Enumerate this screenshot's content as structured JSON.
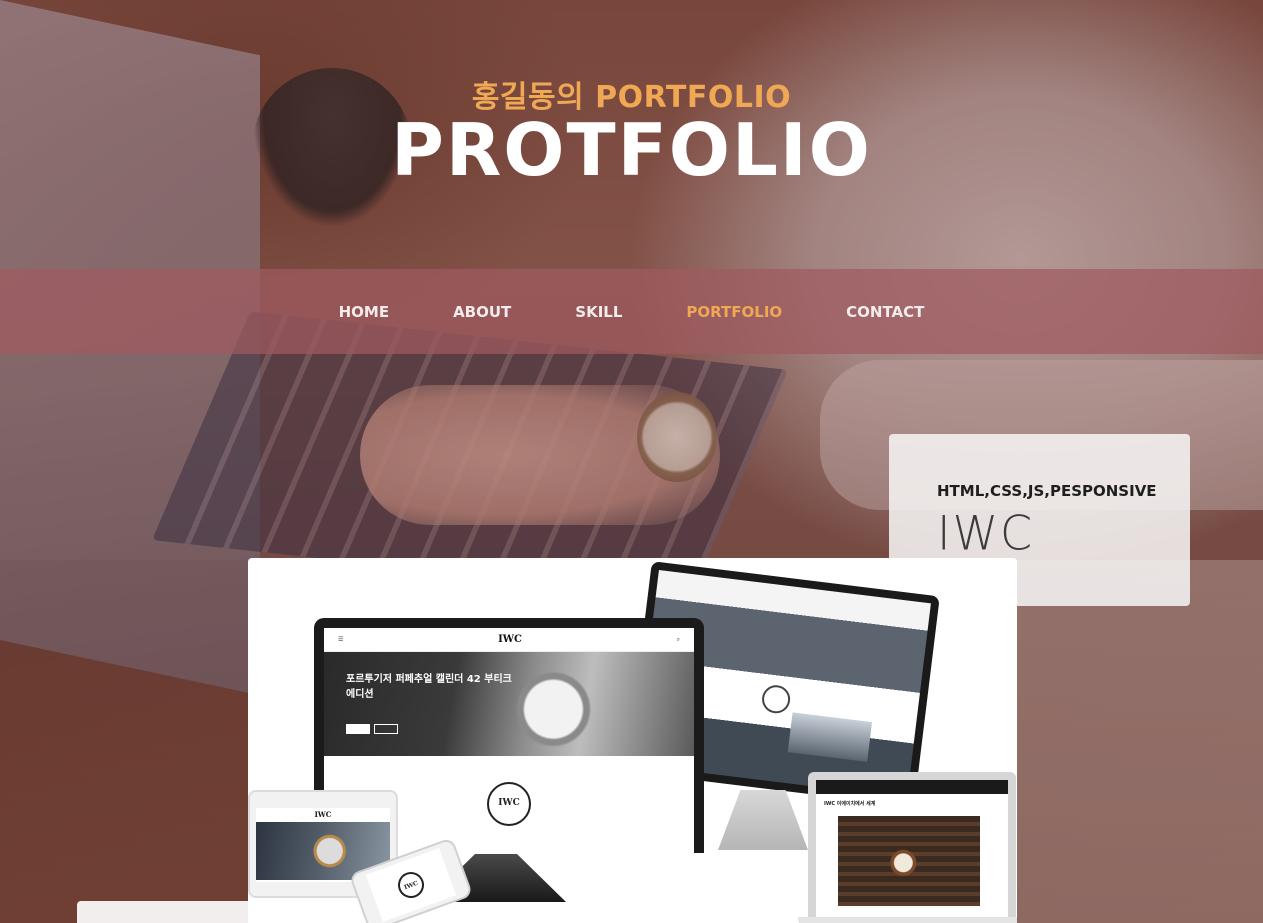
{
  "header": {
    "subtitle": "홍길동의 PORTFOLIO",
    "title": "PROTFOLIO"
  },
  "nav": {
    "items": [
      {
        "label": "HOME",
        "active": false
      },
      {
        "label": "ABOUT",
        "active": false
      },
      {
        "label": "SKILL",
        "active": false
      },
      {
        "label": "PORTFOLIO",
        "active": true
      },
      {
        "label": "CONTACT",
        "active": false
      }
    ]
  },
  "project": {
    "tech": "HTML,CSS,JS,PESPONSIVE",
    "name": "IWC"
  },
  "mockup": {
    "laptop_brand": "IWC",
    "laptop_hero_text": "포르투기저 퍼페추얼 캘린더 42 부티크 에디션",
    "badge_text": "IWC",
    "macbook_title": "IWC 이에이치에서 세계"
  },
  "colors": {
    "accent": "#f0a855",
    "nav_bg": "#a05a60",
    "title": "#ffffff",
    "card_bg": "#f5f2f2"
  }
}
